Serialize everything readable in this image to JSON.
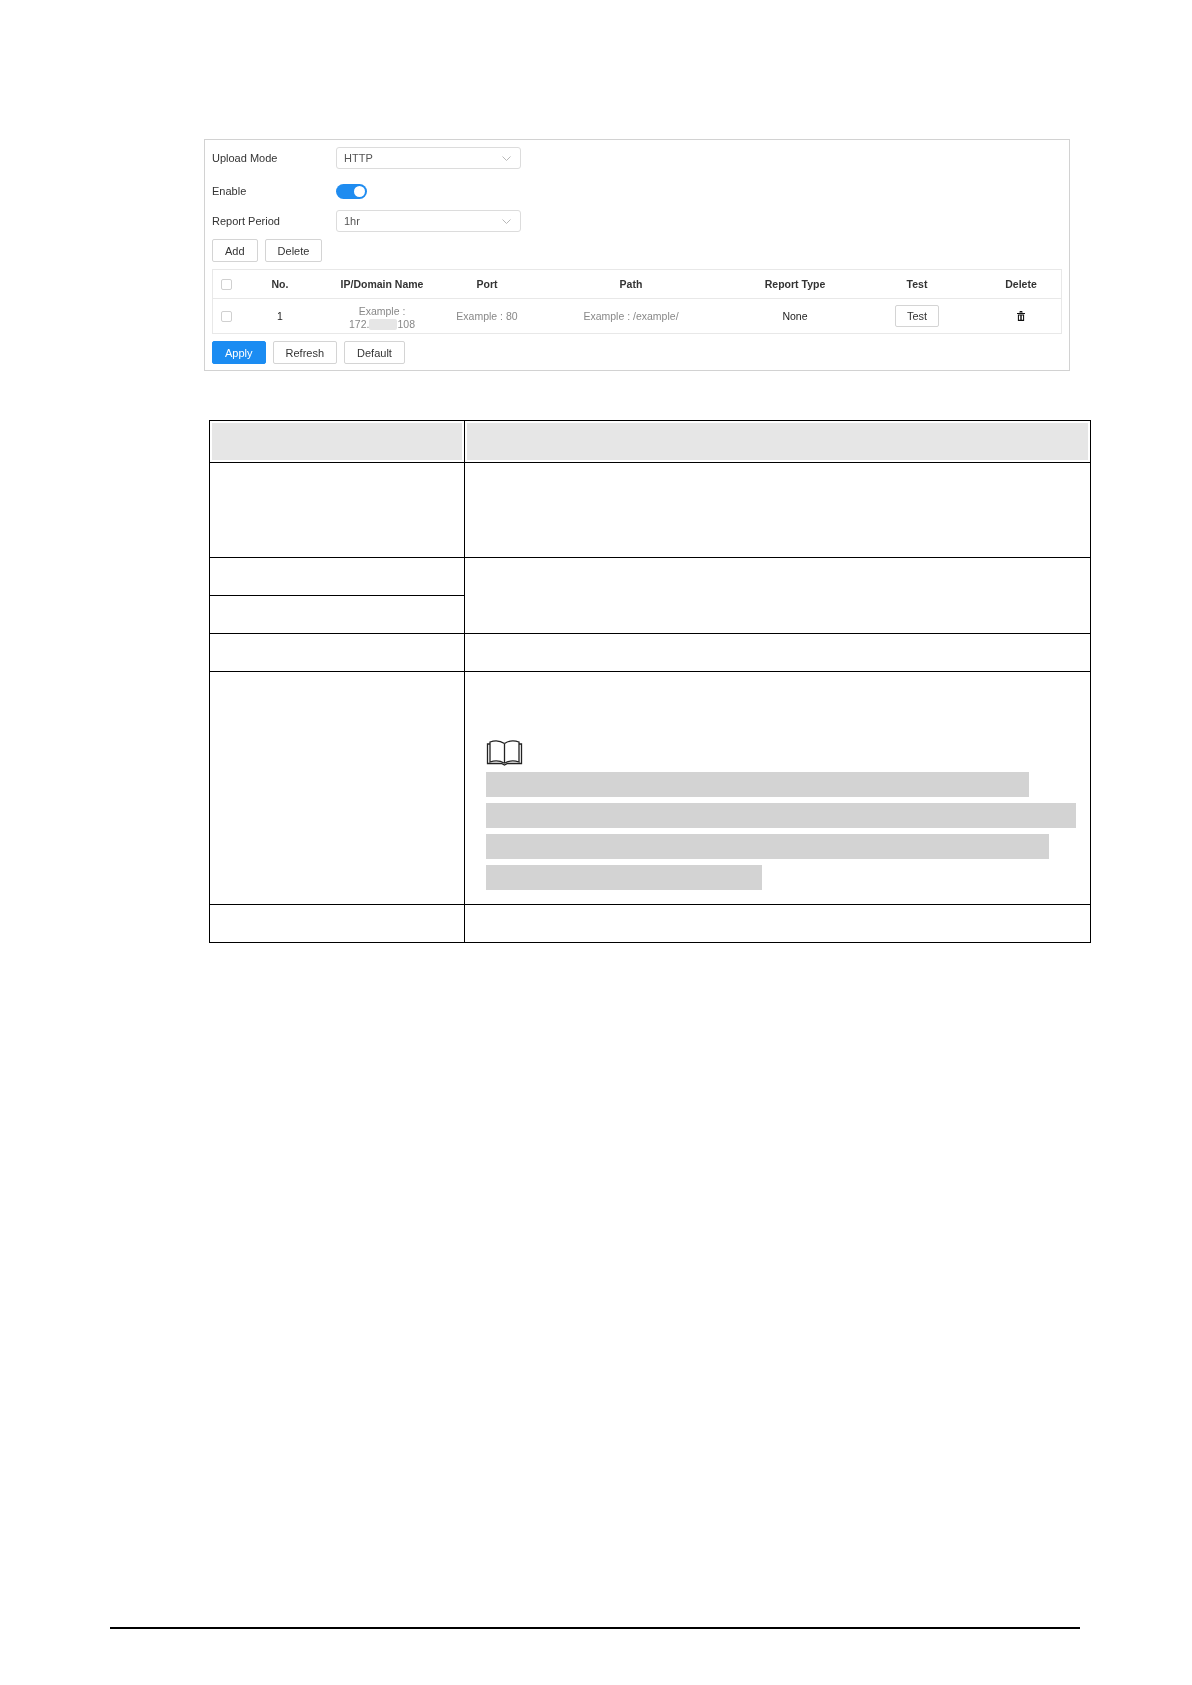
{
  "settings_panel": {
    "fields": [
      {
        "kind": "select",
        "label": "Upload Mode",
        "value": "HTTP"
      },
      {
        "kind": "toggle",
        "label": "Enable",
        "on": true
      },
      {
        "kind": "select",
        "label": "Report Period",
        "value": "1hr"
      }
    ],
    "list_buttons": [
      "Add",
      "Delete"
    ],
    "server_table": {
      "header_checked": false,
      "columns": [
        "No.",
        "IP/Domain Name",
        "Port",
        "Path",
        "Report Type",
        "Test",
        "Delete"
      ],
      "rows": [
        {
          "checked": false,
          "no": "1",
          "ip_domain": {
            "label": "Example :",
            "address_start": "172.",
            "address_end": "108"
          },
          "port": "Example : 80",
          "path": "Example : /example/",
          "report_type": "None",
          "test_button": "Test"
        }
      ]
    },
    "form_buttons": [
      {
        "label": "Apply",
        "primary": true
      },
      {
        "label": "Refresh",
        "primary": false
      },
      {
        "label": "Default",
        "primary": false
      }
    ]
  },
  "description_table": {
    "rows": [
      {
        "kind": "header"
      },
      {
        "kind": "tall"
      },
      {
        "kind": "pair"
      },
      {
        "kind": "single"
      },
      {
        "kind": "note"
      },
      {
        "kind": "single"
      }
    ]
  }
}
